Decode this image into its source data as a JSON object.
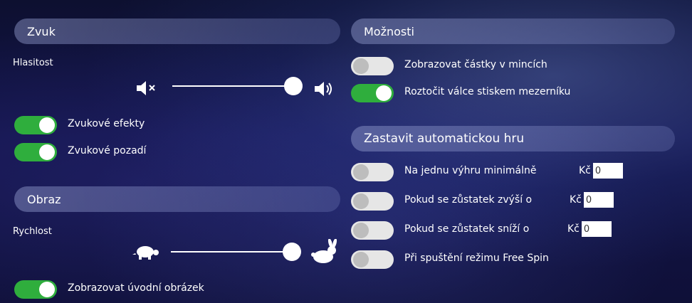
{
  "sound": {
    "header": "Zvuk",
    "volume_label": "Hlasitost",
    "effects_label": "Zvukové efekty",
    "effects_on": true,
    "background_label": "Zvukové pozadí",
    "background_on": true,
    "volume_level": 1.0
  },
  "display": {
    "header": "Obraz",
    "speed_label": "Rychlost",
    "intro_label": "Zobrazovat úvodní obrázek",
    "intro_on": true,
    "speed_level": 1.0
  },
  "options": {
    "header": "Možnosti",
    "coins_label": "Zobrazovat částky v mincích",
    "coins_on": false,
    "spacebar_label": "Roztočit válce stiskem mezerníku",
    "spacebar_on": true
  },
  "autoplay": {
    "header": "Zastavit automatickou hru",
    "currency": "Kč",
    "rows": [
      {
        "label": "Na jednu výhru minimálně",
        "on": false,
        "value": "0"
      },
      {
        "label": "Pokud se zůstatek zvýší o",
        "on": false,
        "value": "0"
      },
      {
        "label": "Pokud se zůstatek sníží o",
        "on": false,
        "value": "0"
      },
      {
        "label": "Při spuštění režimu Free Spin",
        "on": false
      }
    ]
  },
  "icons": {
    "mute": "speaker-mute-icon",
    "volume": "speaker-volume-icon",
    "slow": "turtle-icon",
    "fast": "rabbit-icon"
  }
}
